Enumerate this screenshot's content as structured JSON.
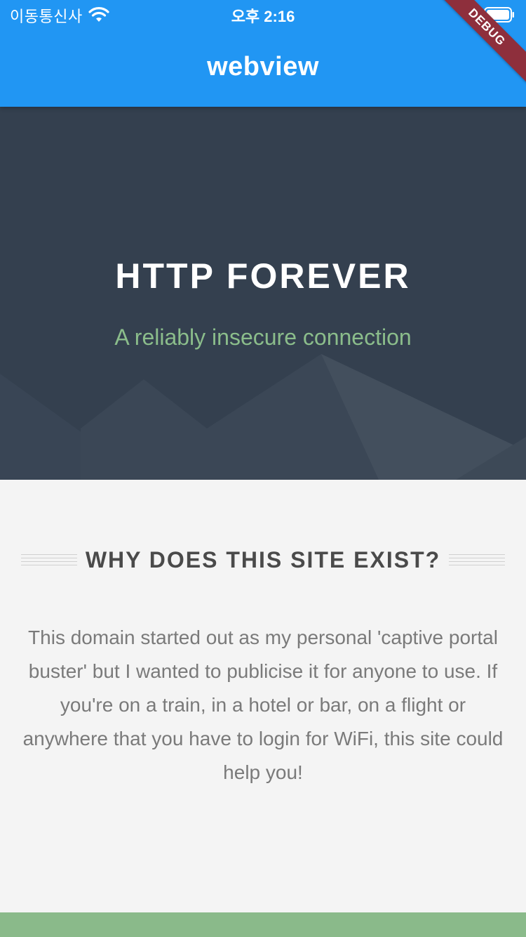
{
  "status_bar": {
    "carrier": "이동통신사",
    "time": "오후 2:16",
    "wifi_icon": "wifi-icon",
    "battery_icon": "battery-icon"
  },
  "app_bar": {
    "title": "webview",
    "color": "#2196f3"
  },
  "debug_banner": "DEBUG",
  "hero": {
    "title": "HTTP FOREVER",
    "subtitle": "A reliably insecure connection",
    "background": "#34404f",
    "subtitle_color": "#8bbd8b"
  },
  "section": {
    "heading": "WHY DOES THIS SITE EXIST?",
    "body": "This domain started out as my personal 'captive portal buster' but I wanted to publicise it for anyone to use. If you're on a train, in a hotel or bar, on a flight or anywhere that you have to login for WiFi, this site could help you!"
  },
  "footer_color": "#8aba8a"
}
